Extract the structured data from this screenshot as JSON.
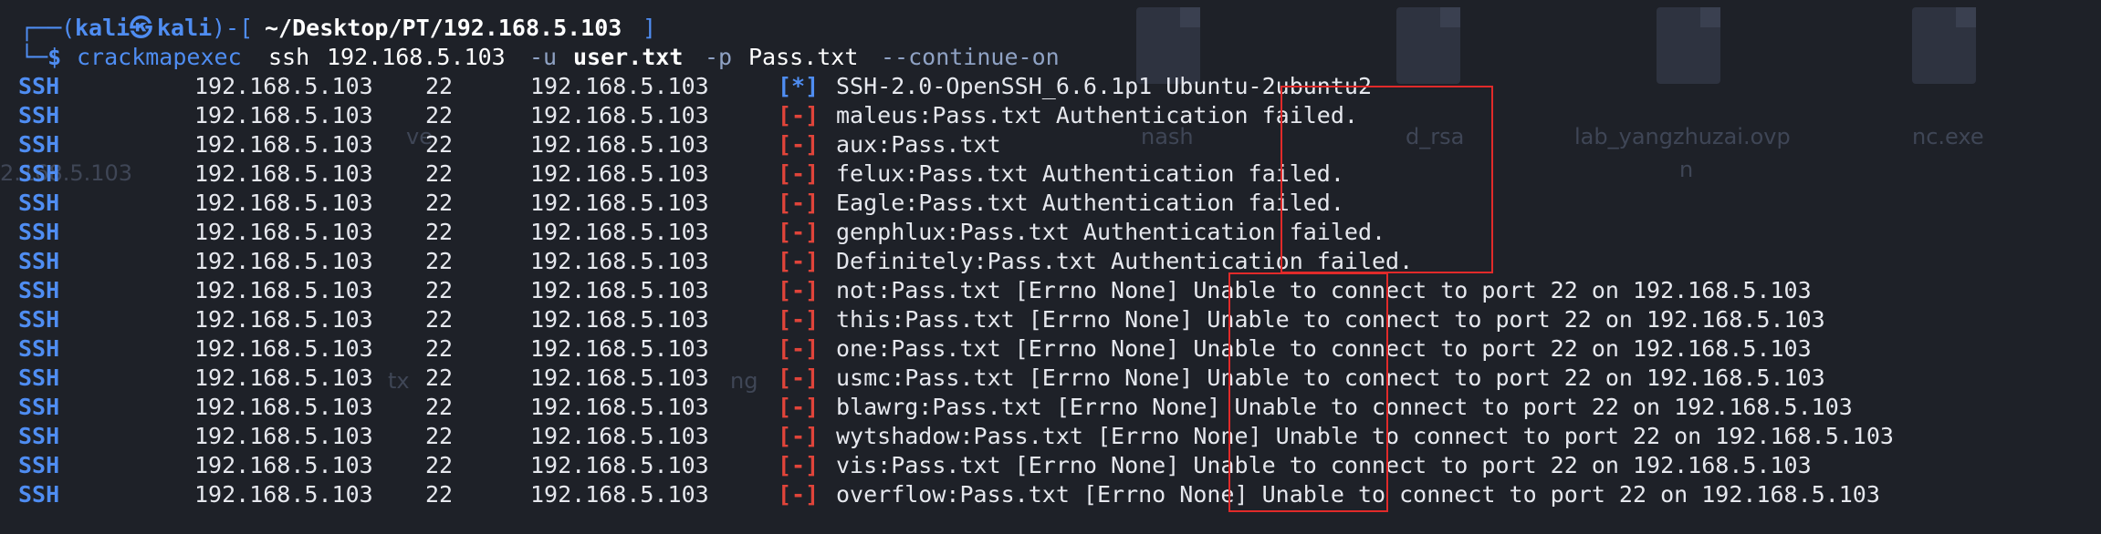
{
  "desktop_ghosts": [
    "nash",
    "d_rsa",
    "lab_yangzhuzai.ovp",
    "n",
    "nc.exe",
    "ve",
    "2.168.5.103",
    "tx",
    "ng"
  ],
  "prompt": {
    "open": "┌──(",
    "user": "kali",
    "at": "㉿",
    "host": "kali",
    "mid": ")-[",
    "path": "~/Desktop/PT/192.168.5.103",
    "close": "]",
    "dollar_prefix": "└─$",
    "command": "crackmapexec",
    "args": [
      {
        "text": "ssh",
        "style": "arg"
      },
      {
        "text": "192.168.5.103",
        "style": "arg"
      },
      {
        "text": "-u",
        "style": "opt"
      },
      {
        "text": "user.txt",
        "style": "bold"
      },
      {
        "text": "-p",
        "style": "opt"
      },
      {
        "text": "Pass.txt",
        "style": "arg"
      },
      {
        "text": "--continue-on",
        "style": "opt"
      }
    ]
  },
  "output_rows": [
    {
      "proto": "SSH",
      "host": "192.168.5.103",
      "port": "22",
      "name": "192.168.5.103",
      "tag": "[*]",
      "status": "info",
      "message": "SSH-2.0-OpenSSH_6.6.1p1 Ubuntu-2ubuntu2"
    },
    {
      "proto": "SSH",
      "host": "192.168.5.103",
      "port": "22",
      "name": "192.168.5.103",
      "tag": "[-]",
      "status": "fail",
      "message": "maleus:Pass.txt Authentication failed."
    },
    {
      "proto": "SSH",
      "host": "192.168.5.103",
      "port": "22",
      "name": "192.168.5.103",
      "tag": "[-]",
      "status": "fail",
      "message": "aux:Pass.txt"
    },
    {
      "proto": "SSH",
      "host": "192.168.5.103",
      "port": "22",
      "name": "192.168.5.103",
      "tag": "[-]",
      "status": "fail",
      "message": "felux:Pass.txt Authentication failed."
    },
    {
      "proto": "SSH",
      "host": "192.168.5.103",
      "port": "22",
      "name": "192.168.5.103",
      "tag": "[-]",
      "status": "fail",
      "message": "Eagle:Pass.txt Authentication failed."
    },
    {
      "proto": "SSH",
      "host": "192.168.5.103",
      "port": "22",
      "name": "192.168.5.103",
      "tag": "[-]",
      "status": "fail",
      "message": "genphlux:Pass.txt Authentication failed."
    },
    {
      "proto": "SSH",
      "host": "192.168.5.103",
      "port": "22",
      "name": "192.168.5.103",
      "tag": "[-]",
      "status": "fail",
      "message": "Definitely:Pass.txt Authentication failed."
    },
    {
      "proto": "SSH",
      "host": "192.168.5.103",
      "port": "22",
      "name": "192.168.5.103",
      "tag": "[-]",
      "status": "fail",
      "message": "not:Pass.txt [Errno None] Unable to connect to port 22 on 192.168.5.103"
    },
    {
      "proto": "SSH",
      "host": "192.168.5.103",
      "port": "22",
      "name": "192.168.5.103",
      "tag": "[-]",
      "status": "fail",
      "message": "this:Pass.txt [Errno None] Unable to connect to port 22 on 192.168.5.103"
    },
    {
      "proto": "SSH",
      "host": "192.168.5.103",
      "port": "22",
      "name": "192.168.5.103",
      "tag": "[-]",
      "status": "fail",
      "message": "one:Pass.txt [Errno None] Unable to connect to port 22 on 192.168.5.103"
    },
    {
      "proto": "SSH",
      "host": "192.168.5.103",
      "port": "22",
      "name": "192.168.5.103",
      "tag": "[-]",
      "status": "fail",
      "message": "usmc:Pass.txt [Errno None] Unable to connect to port 22 on 192.168.5.103"
    },
    {
      "proto": "SSH",
      "host": "192.168.5.103",
      "port": "22",
      "name": "192.168.5.103",
      "tag": "[-]",
      "status": "fail",
      "message": "blawrg:Pass.txt [Errno None] Unable to connect to port 22 on 192.168.5.103"
    },
    {
      "proto": "SSH",
      "host": "192.168.5.103",
      "port": "22",
      "name": "192.168.5.103",
      "tag": "[-]",
      "status": "fail",
      "message": "wytshadow:Pass.txt [Errno None] Unable to connect to port 22 on 192.168.5.103"
    },
    {
      "proto": "SSH",
      "host": "192.168.5.103",
      "port": "22",
      "name": "192.168.5.103",
      "tag": "[-]",
      "status": "fail",
      "message": "vis:Pass.txt [Errno None] Unable to connect to port 22 on 192.168.5.103"
    },
    {
      "proto": "SSH",
      "host": "192.168.5.103",
      "port": "22",
      "name": "192.168.5.103",
      "tag": "[-]",
      "status": "fail",
      "message": "overflow:Pass.txt [Errno None] Unable to connect to port 22 on 192.168.5.103"
    }
  ],
  "colors": {
    "background": "#1e2128",
    "prompt_blue": "#4f8df2",
    "fail_red": "#e0443a",
    "highlight_box": "#e12a2a",
    "text": "#e6e8ee"
  }
}
